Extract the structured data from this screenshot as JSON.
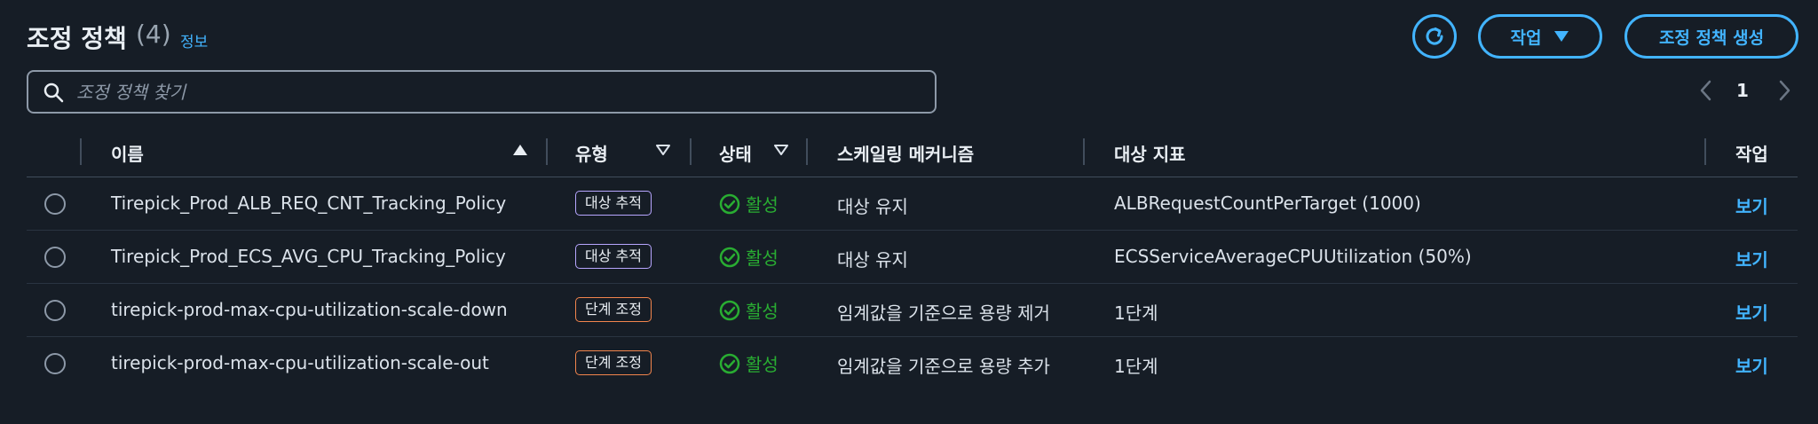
{
  "header": {
    "title": "조정 정책",
    "count": "(4)",
    "info_link": "정보",
    "actions_label": "작업",
    "create_label": "조정 정책 생성"
  },
  "search": {
    "placeholder": "조정 정책 찾기"
  },
  "pagination": {
    "current_page": "1"
  },
  "table": {
    "columns": [
      "이름",
      "유형",
      "상태",
      "스케일링 메커니즘",
      "대상 지표",
      "작업"
    ],
    "rows": [
      {
        "name": "Tirepick_Prod_ALB_REQ_CNT_Tracking_Policy",
        "type": "대상 추적",
        "status": "활성",
        "mechanism": "대상 유지",
        "metric": "ALBRequestCountPerTarget (1000)",
        "action": "보기"
      },
      {
        "name": "Tirepick_Prod_ECS_AVG_CPU_Tracking_Policy",
        "type": "대상 추적",
        "status": "활성",
        "mechanism": "대상 유지",
        "metric": "ECSServiceAverageCPUUtilization (50%)",
        "action": "보기"
      },
      {
        "name": "tirepick-prod-max-cpu-utilization-scale-down",
        "type": "단계 조정",
        "status": "활성",
        "mechanism": "임계값을 기준으로 용량 제거",
        "metric": "1단계",
        "action": "보기"
      },
      {
        "name": "tirepick-prod-max-cpu-utilization-scale-out",
        "type": "단계 조정",
        "status": "활성",
        "mechanism": "임계값을 기준으로 용량 추가",
        "metric": "1단계",
        "action": "보기"
      }
    ]
  },
  "colors": {
    "background": "#161d26",
    "accent": "#42b4ff",
    "status_active": "#29ad32",
    "badge_target_tracking": "#b7a6ff",
    "badge_step_scaling": "#f2854d"
  }
}
